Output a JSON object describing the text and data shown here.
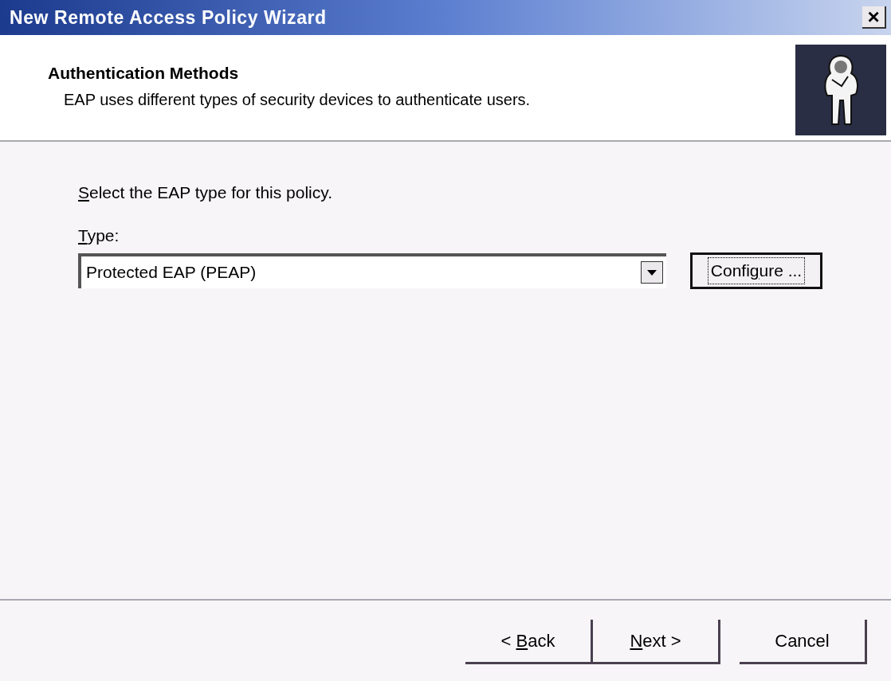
{
  "window": {
    "title": "New Remote Access Policy Wizard",
    "close_label": "×"
  },
  "header": {
    "title": "Authentication Methods",
    "subtitle": "EAP uses different types of security devices to authenticate users."
  },
  "prompt": {
    "key": "S",
    "after": "elect the EAP type for this policy."
  },
  "type_label": {
    "key": "T",
    "after": "ype:"
  },
  "type_select": {
    "value": "Protected EAP (PEAP)"
  },
  "configure_button": {
    "before": "Confi",
    "key": "g",
    "after": "ure ...",
    "focused": true
  },
  "buttons": [
    {
      "before": "< ",
      "key": "B",
      "after": "ack"
    },
    {
      "key": "N",
      "after": "ext >"
    },
    {
      "before": "Cancel"
    }
  ]
}
